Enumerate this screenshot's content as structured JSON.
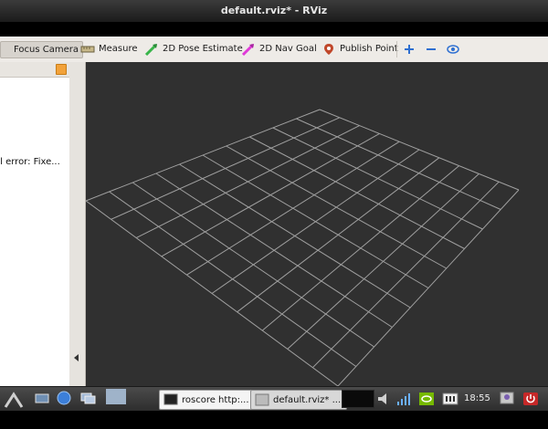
{
  "window": {
    "title": "default.rviz* - RViz"
  },
  "toolbar": {
    "tools": [
      {
        "label": "Focus Camera",
        "icon": "focus-camera-icon",
        "active": true
      },
      {
        "label": "Measure",
        "icon": "ruler-icon",
        "active": false
      },
      {
        "label": "2D Pose Estimate",
        "icon": "green-arrow-icon",
        "active": false
      },
      {
        "label": "2D Nav Goal",
        "icon": "magenta-arrow-icon",
        "active": false
      },
      {
        "label": "Publish Point",
        "icon": "map-pin-icon",
        "active": false
      }
    ],
    "extra_icons": [
      "plus-icon",
      "minus-icon",
      "eye-icon"
    ]
  },
  "displays_panel": {
    "error_text": "al error: Fixe..."
  },
  "viewport": {
    "background": "#303030",
    "grid_color": "#a0a0a0"
  },
  "taskbar": {
    "tasks": [
      {
        "label": "roscore http:..."
      },
      {
        "label": "default.rviz* ..."
      }
    ],
    "clock": "18:55"
  }
}
